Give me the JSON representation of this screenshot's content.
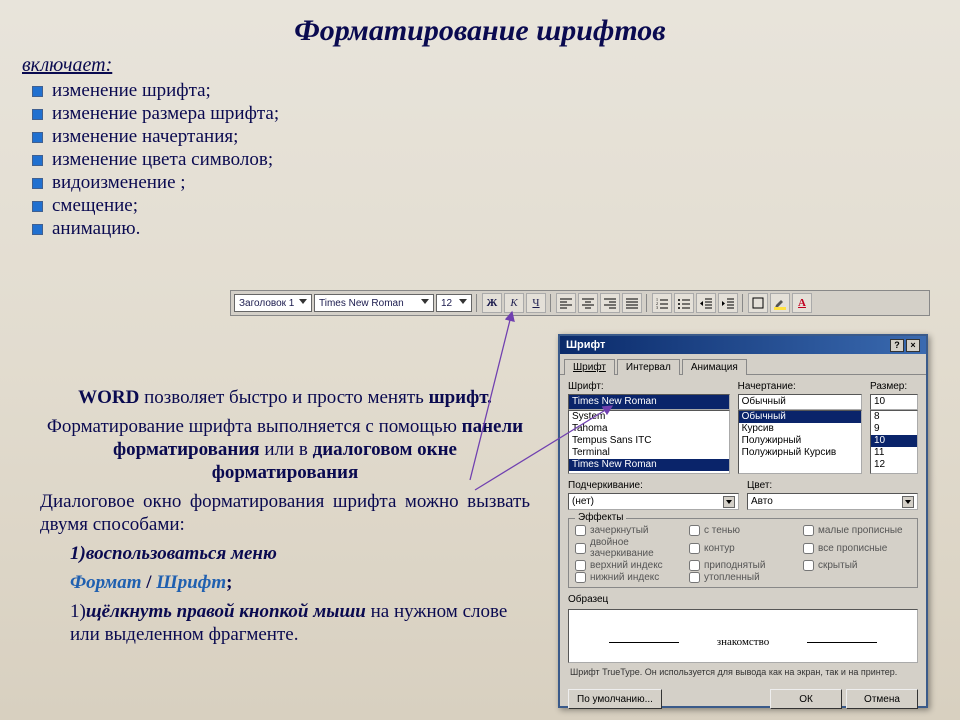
{
  "title": "Форматирование шрифтов",
  "includes_label": "включает:",
  "bullets": [
    "изменение шрифта;",
    "изменение размера шрифта;",
    "изменение начертания;",
    "изменение цвета символов;",
    "видоизменение ;",
    "смещение;",
    "анимацию."
  ],
  "body1_pre": "WORD",
  "body1_mid": " позволяет быстро и просто менять ",
  "body1_b": "шрифт.",
  "body2_pre": "Форматирование шрифта выполняется с помощью ",
  "body2_b1": "панели форматирования",
  "body2_mid": " или в ",
  "body2_b2": "диалоговом окне форматирования",
  "body3": "Диалоговое окно форматирования шрифта можно вызвать двумя способами:",
  "body4": "1)воспользоваться меню",
  "body4a_1": "Формат",
  "body4a_sep": " / ",
  "body4a_2": "Шрифт",
  "body4a_end": ";",
  "body5_num": "1)",
  "body5_b": "щёлкнуть правой кнопкой мыши",
  "body5_rest": " на нужном слове или выделенном фрагменте.",
  "toolbar": {
    "style": "Заголовок 1",
    "font": "Times New Roman",
    "size": "12",
    "bold": "Ж",
    "italic": "К",
    "underline": "Ч",
    "color_a": "А"
  },
  "dialog": {
    "title": "Шрифт",
    "tabs": {
      "font": "Шрифт",
      "interval": "Интервал",
      "anim": "Анимация"
    },
    "labels": {
      "font": "Шрифт:",
      "style": "Начертание:",
      "size": "Размер:",
      "underline": "Подчеркивание:",
      "color": "Цвет:",
      "effects": "Эффекты",
      "sample": "Образец"
    },
    "font_value": "Times New Roman",
    "font_list": [
      "System",
      "Tahoma",
      "Tempus Sans ITC",
      "Terminal",
      "Times New Roman"
    ],
    "style_value": "Обычный",
    "style_list": [
      "Обычный",
      "Курсив",
      "Полужирный",
      "Полужирный Курсив"
    ],
    "size_value": "10",
    "size_list": [
      "8",
      "9",
      "10",
      "11",
      "12"
    ],
    "underline_value": "(нет)",
    "color_value": "Авто",
    "effects": [
      "зачеркнутый",
      "с тенью",
      "малые прописные",
      "двойное зачеркивание",
      "контур",
      "все прописные",
      "верхний индекс",
      "приподнятый",
      "скрытый",
      "нижний индекс",
      "утопленный"
    ],
    "sample_text": "знакомство",
    "hint": "Шрифт TrueType. Он используется для вывода как на экран, так и на принтер.",
    "default_btn": "По умолчанию...",
    "ok_btn": "ОК",
    "cancel_btn": "Отмена"
  }
}
